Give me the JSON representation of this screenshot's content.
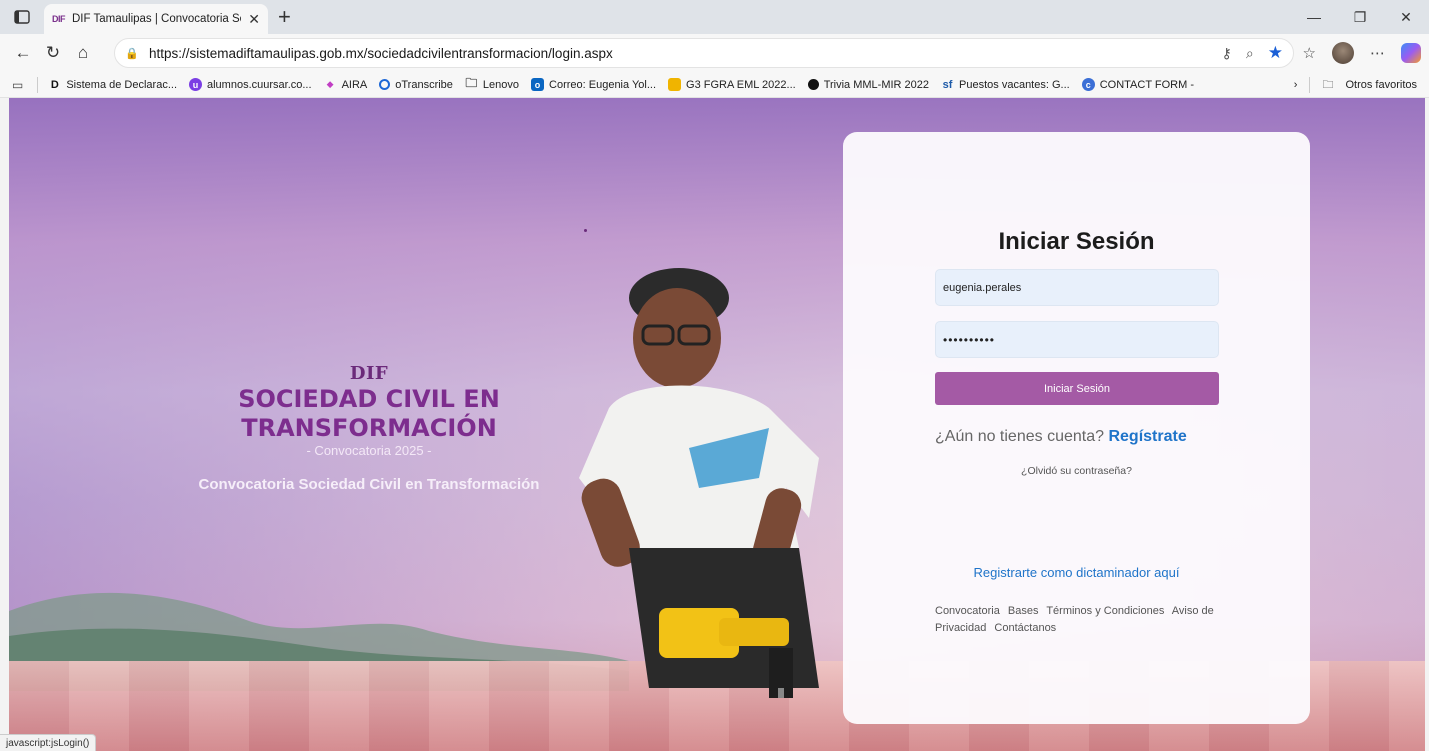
{
  "browser": {
    "tab_title": "DIF Tamaulipas | Convocatoria Soc",
    "tab_favicon_text": "DIF",
    "url": "https://sistemadiftamaulipas.gob.mx/sociedadcivilentransformacion/login.aspx",
    "bookmarks": [
      {
        "label": "Sistema de Declarac...",
        "icon": "D",
        "color": "#1a1a1a"
      },
      {
        "label": "alumnos.cuursar.co...",
        "icon": "uu",
        "color": "#7b3fe4"
      },
      {
        "label": "AIRA",
        "icon": "a",
        "color": "#c13ec4"
      },
      {
        "label": "oTranscribe",
        "icon": "o",
        "color": "#1d67d6"
      },
      {
        "label": "Lenovo",
        "icon": "folder",
        "color": "#555555"
      },
      {
        "label": "Correo: Eugenia Yol...",
        "icon": "o",
        "color": "#0a66c2"
      },
      {
        "label": "G3 FGRA EML 2022...",
        "icon": "sheet",
        "color": "#f0b400"
      },
      {
        "label": "Trivia MML-MIR 2022",
        "icon": "circle",
        "color": "#111111"
      },
      {
        "label": "Puestos vacantes: G...",
        "icon": "sf",
        "color": "#1d5aa8"
      },
      {
        "label": "CONTACT FORM -",
        "icon": "c",
        "color": "#3b6fd6"
      }
    ],
    "other_favorites": "Otros favoritos",
    "status_text": "javascript:jsLogin()"
  },
  "brand": {
    "logo": "DIF",
    "title_line1": "SOCIEDAD CIVIL EN",
    "title_line2": "TRANSFORMACIÓN",
    "subtitle": "- Convocatoria 2025 -",
    "tagline": "Convocatoria Sociedad Civil en Transformación"
  },
  "login": {
    "title": "Iniciar Sesión",
    "username_value": "eugenia.perales",
    "password_value": "••••••••••",
    "submit_label": "Iniciar Sesión",
    "signup_prompt": "¿Aún no tienes cuenta?",
    "signup_link": "Regístrate",
    "forgot_password": "¿Olvidó su contraseña?",
    "evaluator_link": "Registrarte como dictaminador aquí",
    "footer_links": [
      "Convocatoria",
      "Bases",
      "Términos y Condiciones",
      "Aviso de Privacidad",
      "Contáctanos"
    ]
  },
  "colors": {
    "accent_button": "#a45aa5",
    "link_blue": "#1f74c9",
    "brand_purple": "#7d2d8e"
  }
}
